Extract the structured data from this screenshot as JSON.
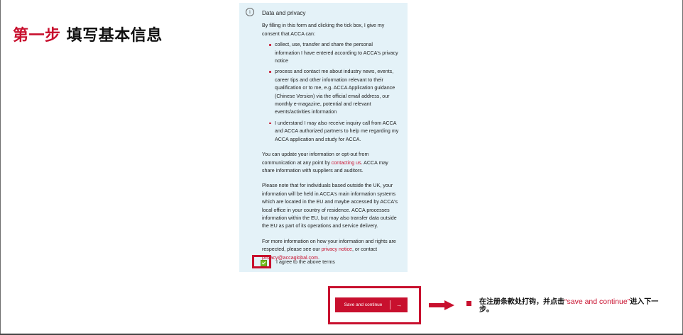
{
  "step": {
    "accent": "第一步",
    "main": "填写基本信息"
  },
  "privacy": {
    "icon": "info-icon",
    "icon_glyph": "i",
    "title": "Data and privacy",
    "intro": "By filling in this form and clicking the tick box, I give my consent that ACCA can:",
    "bullets": [
      "collect, use, transfer and share the personal information I have entered according to ACCA's privacy notice",
      "process and contact me about industry news, events, career tips and other information relevant to their qualification or to me, e.g. ACCA Application guidance (Chinese Version) via the official email address, our monthly e-magazine, potential and relevant events/activities information",
      "I understand I may also receive inquiry call from ACCA and ACCA authorized partners to help me regarding my ACCA application and study for ACCA."
    ],
    "update_pre": "You can update your information or opt-out from communication at any point by ",
    "contact_link": "contacting us",
    "update_post": ". ACCA may share information with suppliers and auditors.",
    "uk_note": "Please note that for individuals based outside the UK, your information will be held in ACCA's main information systems which are located in the EU and maybe accessed by ACCA's local office in your country of residence. ACCA processes information within the EU, but may also transfer data outside the EU as part of its operations and service delivery.",
    "more_pre": "For more information on how your information and rights are respected, please see our ",
    "privacy_link": "privacy notice",
    "more_mid": ", or contact ",
    "email_link": "privacy@accaglobal.com",
    "more_post": "."
  },
  "agree": {
    "checked": true,
    "label": "I agree to the above terms"
  },
  "button": {
    "label": "Save and continue",
    "arrow": "→"
  },
  "annotation": {
    "pre": "在注册条款处打钩，并点击",
    "quoted": "“save and continue”",
    "post": "进入下一步。"
  },
  "colors": {
    "accent": "#c8102e",
    "card_bg": "#e4f2f8",
    "checkbox": "#78be20"
  }
}
